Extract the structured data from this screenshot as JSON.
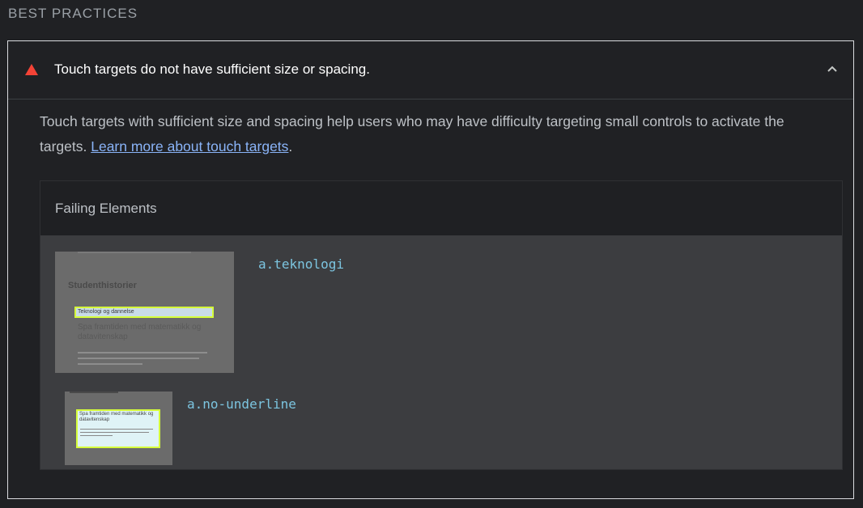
{
  "section": {
    "title": "BEST PRACTICES"
  },
  "audit": {
    "title": "Touch targets do not have sufficient size or spacing.",
    "status": "fail",
    "status_color": "#f44336",
    "description_text": "Touch targets with sufficient size and spacing help users who may have difficulty targeting small controls to activate the targets. ",
    "learn_more_link": "Learn more about touch targets",
    "description_end": ".",
    "expanded": true
  },
  "details": {
    "title": "Failing Elements",
    "items": [
      {
        "selector": "a.teknologi",
        "thumbnail": {
          "heading": "Studenthistorier",
          "highlight_text": "Teknologi og dannelse",
          "body_text": "Spa framtiden med matematikk og datavitenskap"
        }
      },
      {
        "selector": "a.no-underline",
        "thumbnail": {
          "body_text": "Spa framtiden med matematikk og datavitenskap"
        }
      }
    ]
  }
}
